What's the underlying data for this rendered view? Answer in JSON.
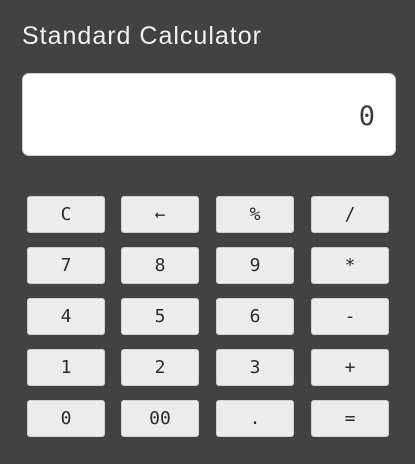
{
  "app": {
    "title": "Standard Calculator"
  },
  "display": {
    "value": "0"
  },
  "keys": {
    "clear": "C",
    "backspace": "←",
    "percent": "%",
    "divide": "/",
    "seven": "7",
    "eight": "8",
    "nine": "9",
    "multiply": "*",
    "four": "4",
    "five": "5",
    "six": "6",
    "subtract": "-",
    "one": "1",
    "two": "2",
    "three": "3",
    "add": "+",
    "zero": "0",
    "double_zero": "00",
    "decimal": ".",
    "equals": "="
  }
}
